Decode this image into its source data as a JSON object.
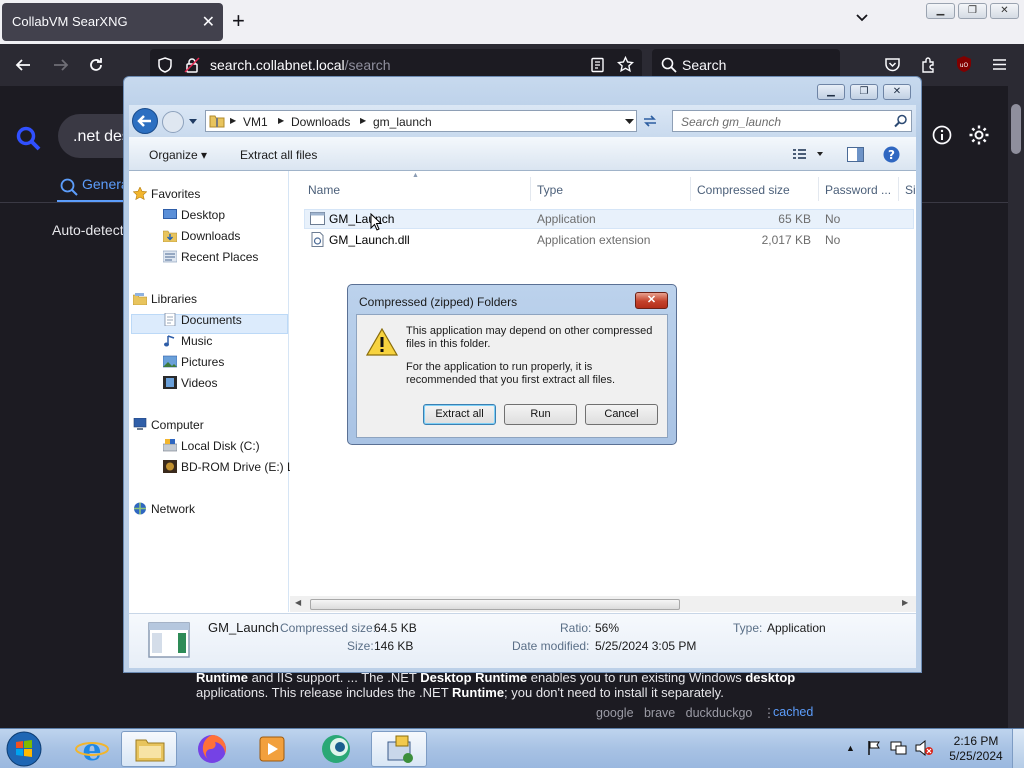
{
  "browser": {
    "tab_title": "CollabVM SearXNG",
    "tab_close": "✕",
    "new_tab": "+",
    "url_host": "search.collabnet.local",
    "url_path": "/search",
    "search_placeholder": "Search"
  },
  "searx": {
    "query": ".net des",
    "category": "Genera",
    "auto_detect": "Auto-detect",
    "snippet_line1_parts": [
      "Runtime",
      " and IIS support. ... The .NET ",
      "Desktop Runtime",
      " enables you to run existing Windows ",
      "desktop"
    ],
    "snippet_line2_parts": [
      "applications. This release includes the .NET ",
      "Runtime",
      "; you don't need to install it separately."
    ],
    "engines": "google   brave   duckduckgo",
    "engines_sep": "⋮",
    "cached": "cached"
  },
  "explorer": {
    "breadcrumb": [
      "VM1",
      "Downloads",
      "gm_launch"
    ],
    "search_placeholder": "Search gm_launch",
    "commands": {
      "organize": "Organize",
      "extract_all": "Extract all files"
    },
    "nav": {
      "favorites": "Favorites",
      "desktop": "Desktop",
      "downloads": "Downloads",
      "recent_places": "Recent Places",
      "libraries": "Libraries",
      "documents": "Documents",
      "music": "Music",
      "pictures": "Pictures",
      "videos": "Videos",
      "computer": "Computer",
      "local_disk": "Local Disk (C:)",
      "bd_rom": "BD-ROM Drive (E:) L",
      "network": "Network"
    },
    "columns": [
      "Name",
      "Type",
      "Compressed size",
      "Password ...",
      "Si"
    ],
    "files": [
      {
        "name": "GM_Launch",
        "type": "Application",
        "size": "65 KB",
        "password": "No"
      },
      {
        "name": "GM_Launch.dll",
        "type": "Application extension",
        "size": "2,017 KB",
        "password": "No"
      }
    ],
    "details": {
      "name": "GM_Launch",
      "compressed_label": "Compressed size:",
      "compressed_value": "64.5 KB",
      "size_label": "Size:",
      "size_value": "146 KB",
      "ratio_label": "Ratio:",
      "ratio_value": "56%",
      "modified_label": "Date modified:",
      "modified_value": "5/25/2024 3:05 PM",
      "type_label": "Type:",
      "type_value": "Application"
    }
  },
  "dialog": {
    "title": "Compressed (zipped) Folders",
    "message1": "This application may depend on other compressed files in this folder.",
    "message2": "For the application to run properly, it is recommended that you first extract all files.",
    "buttons": {
      "extract": "Extract all",
      "run": "Run",
      "cancel": "Cancel"
    }
  },
  "taskbar": {
    "time": "2:16 PM",
    "date": "5/25/2024"
  },
  "colors": {
    "firefox_toolbar": "#2b2a33",
    "searx_accent": "#5c9dfb",
    "win7_titlebar": "#bcd0e8"
  }
}
